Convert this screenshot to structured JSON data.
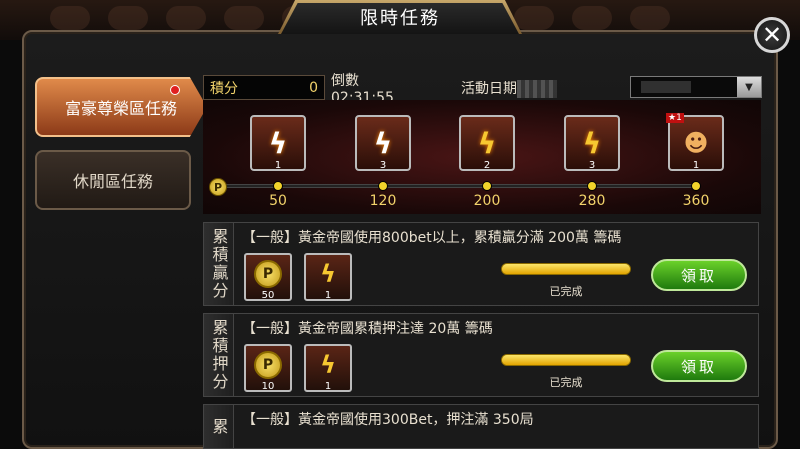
{
  "title": "限時任務",
  "close_label": "✕",
  "sidebar": {
    "tabs": [
      {
        "label": "富豪尊榮區任務",
        "active": true
      },
      {
        "label": "休閒區任務",
        "active": false
      }
    ]
  },
  "header": {
    "score_label": "積分",
    "score_value": "0",
    "countdown": "倒數 02:31:55",
    "date_label": "活動日期",
    "dropdown_arrow": "▼"
  },
  "milestones": {
    "rewards": [
      {
        "icon": "bolt-icon",
        "count": "1",
        "color": "white"
      },
      {
        "icon": "bolt-icon",
        "count": "3",
        "color": "white"
      },
      {
        "icon": "bolt-icon",
        "count": "2",
        "color": "gold"
      },
      {
        "icon": "bolt-icon",
        "count": "3",
        "color": "gold"
      },
      {
        "icon": "avatar-icon",
        "count": "1",
        "badge": "★1"
      }
    ],
    "coin_label": "P",
    "points": [
      "50",
      "120",
      "200",
      "280",
      "360"
    ]
  },
  "tasks": [
    {
      "category": "累積贏分",
      "description": "【一般】黃金帝國使用800bet以上，累積贏分滿 200萬 籌碼",
      "rewards": [
        {
          "type": "coin",
          "label": "P",
          "count": "50"
        },
        {
          "type": "bolt",
          "count": "1"
        }
      ],
      "progress": 1.0,
      "status": "已完成",
      "button": "領取"
    },
    {
      "category": "累積押分",
      "description": "【一般】黃金帝國累積押注達 20萬 籌碼",
      "rewards": [
        {
          "type": "coin",
          "label": "P",
          "count": "10"
        },
        {
          "type": "bolt",
          "count": "1"
        }
      ],
      "progress": 1.0,
      "status": "已完成",
      "button": "領取"
    },
    {
      "category": "累",
      "description": "【一般】黃金帝國使用300Bet，押注滿 350局"
    }
  ]
}
